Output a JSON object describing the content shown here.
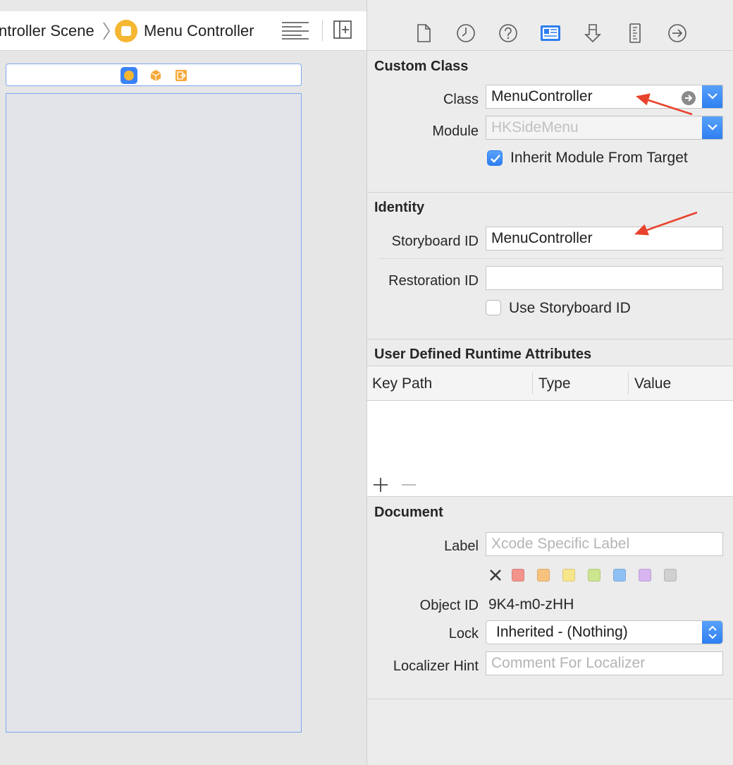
{
  "jumpbar": {
    "crumb_scene": "ntroller Scene",
    "crumb_controller": "Menu Controller"
  },
  "inspector": {
    "custom_class": {
      "title": "Custom Class",
      "class_label": "Class",
      "class_value": "MenuController",
      "module_label": "Module",
      "module_placeholder": "HKSideMenu",
      "inherit_label": "Inherit Module From Target",
      "inherit_checked": true
    },
    "identity": {
      "title": "Identity",
      "storyboard_id_label": "Storyboard ID",
      "storyboard_id_value": "MenuController",
      "restoration_id_label": "Restoration ID",
      "restoration_id_value": "",
      "use_storyboard_id_label": "Use Storyboard ID",
      "use_storyboard_id_checked": false
    },
    "runtime_attributes": {
      "title": "User Defined Runtime Attributes",
      "columns": [
        "Key Path",
        "Type",
        "Value"
      ],
      "rows": []
    },
    "document": {
      "title": "Document",
      "label_label": "Label",
      "label_placeholder": "Xcode Specific Label",
      "object_id_label": "Object ID",
      "object_id_value": "9K4-m0-zHH",
      "lock_label": "Lock",
      "lock_value": "Inherited - (Nothing)",
      "localizer_hint_label": "Localizer Hint",
      "localizer_hint_placeholder": "Comment For Localizer",
      "label_colors": [
        "#f2938c",
        "#f7c27e",
        "#f7e58a",
        "#cde58f",
        "#8fc1f5",
        "#d7b5ef",
        "#d0d0d0"
      ]
    }
  },
  "theme": {
    "accent": "#2d7ef0",
    "annotation_arrow": "#e8432d",
    "selection_outline": "#7ea8f0"
  }
}
